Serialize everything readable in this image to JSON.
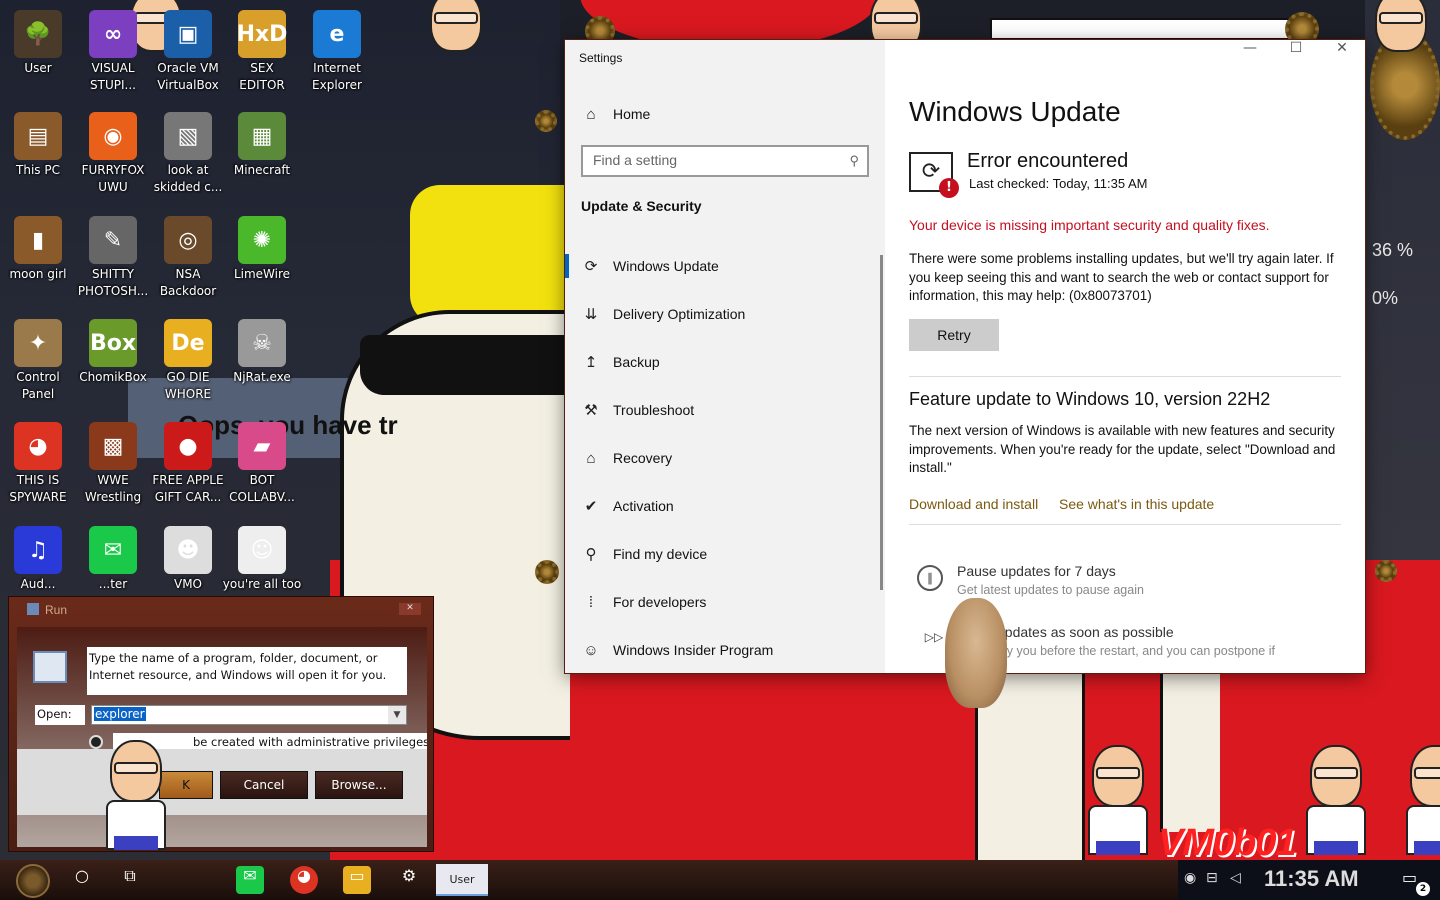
{
  "desktop": {
    "icons": [
      {
        "label": "User",
        "glyph": "🌳",
        "color": "#4a3a2a"
      },
      {
        "label": "VISUAL\nSTUPI...",
        "glyph": "∞",
        "color": "#7b3fbf"
      },
      {
        "label": "Oracle VM\nVirtualBox",
        "glyph": "▣",
        "color": "#1b5fa8"
      },
      {
        "label": "SEX\nEDITOR",
        "glyph": "HxD",
        "color": "#d8a02a"
      },
      {
        "label": "Internet\nExplorer",
        "glyph": "e",
        "color": "#1a7ad4"
      },
      {
        "label": "This PC",
        "glyph": "▤",
        "color": "#8a5a2a"
      },
      {
        "label": "FURRYFOX\nUWU",
        "glyph": "◉",
        "color": "#e8601a"
      },
      {
        "label": "look at\nskidded c...",
        "glyph": "▧",
        "color": "#777"
      },
      {
        "label": "Minecraft",
        "glyph": "▦",
        "color": "#5a8a3a"
      },
      {
        "label": "moon girl",
        "glyph": "▮",
        "color": "#8a5a2a"
      },
      {
        "label": "SHITTY\nPHOTOSH...",
        "glyph": "✎",
        "color": "#666"
      },
      {
        "label": "NSA\nBackdoor",
        "glyph": "◎",
        "color": "#6a4a2a"
      },
      {
        "label": "LimeWire",
        "glyph": "✺",
        "color": "#4ab82a"
      },
      {
        "label": "Control\nPanel",
        "glyph": "✦",
        "color": "#9a7a4a"
      },
      {
        "label": "ChomikBox",
        "glyph": "Box",
        "color": "#6a9a2a"
      },
      {
        "label": "GO DIE\nWHORE",
        "glyph": "De",
        "color": "#e8b020"
      },
      {
        "label": "NjRat.exe",
        "glyph": "☠",
        "color": "#999"
      },
      {
        "label": "THIS IS\nSPYWARE",
        "glyph": "◕",
        "color": "#dd3322"
      },
      {
        "label": "WWE\nWrestling",
        "glyph": "▩",
        "color": "#8a3a1a"
      },
      {
        "label": "FREE APPLE\nGIFT CAR...",
        "glyph": "●",
        "color": "#cc1a1a"
      },
      {
        "label": "BOT\nCOLLABV...",
        "glyph": "▰",
        "color": "#d84a8a"
      },
      {
        "label": "Aud...",
        "glyph": "♫",
        "color": "#2a3ad8"
      },
      {
        "label": "...ter",
        "glyph": "✉",
        "color": "#1ac84a"
      },
      {
        "label": "VMO",
        "glyph": "☻",
        "color": "#ddd"
      },
      {
        "label": "you're all too",
        "glyph": "☺",
        "color": "#eee"
      }
    ]
  },
  "wallpaper": {
    "banner_text": "Oops, you have tr",
    "percent_1": "36 %",
    "percent_2": "0%",
    "watermark": "VM0b01"
  },
  "settings": {
    "app_title": "Settings",
    "home_label": "Home",
    "search_placeholder": "Find a setting",
    "section_title": "Update & Security",
    "nav_items": [
      {
        "label": "Windows Update",
        "icon": "sync-icon",
        "glyph": "⟳"
      },
      {
        "label": "Delivery Optimization",
        "icon": "delivery-icon",
        "glyph": "⇊"
      },
      {
        "label": "Backup",
        "icon": "backup-icon",
        "glyph": "↥"
      },
      {
        "label": "Troubleshoot",
        "icon": "wrench-icon",
        "glyph": "⚒"
      },
      {
        "label": "Recovery",
        "icon": "recovery-icon",
        "glyph": "⌂"
      },
      {
        "label": "Activation",
        "icon": "check-circle-icon",
        "glyph": "✔"
      },
      {
        "label": "Find my device",
        "icon": "person-pin-icon",
        "glyph": "⚲"
      },
      {
        "label": "For developers",
        "icon": "developer-icon",
        "glyph": "⁞"
      },
      {
        "label": "Windows Insider Program",
        "icon": "insider-cat-icon",
        "glyph": "☺"
      }
    ],
    "window_controls": {
      "minimize": "—",
      "maximize": "☐",
      "close": "✕"
    }
  },
  "windows_update": {
    "title": "Windows Update",
    "status_title": "Error encountered",
    "last_checked": "Last checked: Today, 11:35 AM",
    "warning": "Your device is missing important security and quality fixes.",
    "body": "There were some problems installing updates, but we'll try again later. If you keep seeing this and want to search the web or contact support for information, this may help: (0x80073701)",
    "retry_label": "Retry",
    "feature_title": "Feature update to Windows 10, version 22H2",
    "feature_body": "The next version of Windows is available with new features and security improvements. When you're ready for the update, select \"Download and install.\"",
    "download_link": "Download and install",
    "whats_new_link": "See what's in this update",
    "pause_title": "Pause updates for 7 days",
    "pause_sub": "Get latest updates to pause again",
    "asap_title": "updates as soon as possible",
    "asap_sub": "tify you before the restart, and you can postpone if"
  },
  "run_dialog": {
    "title": "Run",
    "close": "✕",
    "description": "Type the name of a program, folder, document, or Internet resource, and Windows will open it for you.",
    "open_label": "Open:",
    "open_value": "explorer",
    "admin_note": "be created with administrative privileges.",
    "ok_label": "K",
    "cancel_label": "Cancel",
    "browse_label": "Browse..."
  },
  "taskbar": {
    "user_label": "User",
    "time": "11:35 AM",
    "notification_count": "2"
  }
}
